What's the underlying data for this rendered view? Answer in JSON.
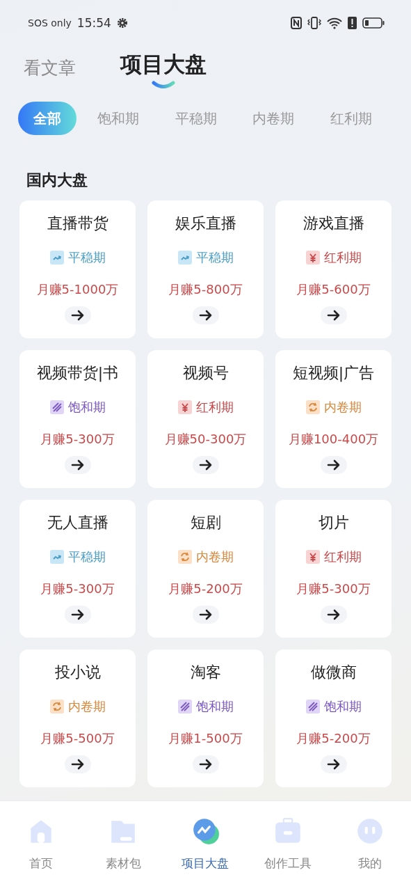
{
  "status_bar": {
    "carrier": "SOS only",
    "time": "15:54"
  },
  "top_tabs": [
    {
      "label": "看文章",
      "selected": false
    },
    {
      "label": "项目大盘",
      "selected": true
    }
  ],
  "filters": [
    {
      "label": "全部",
      "selected": true
    },
    {
      "label": "饱和期",
      "selected": false
    },
    {
      "label": "平稳期",
      "selected": false
    },
    {
      "label": "内卷期",
      "selected": false
    },
    {
      "label": "红利期",
      "selected": false
    }
  ],
  "section_title": "国内大盘",
  "projects": [
    {
      "name": "直播带货",
      "phase": "平稳期",
      "kind": "stable",
      "earnings": "月赚5-1000万"
    },
    {
      "name": "娱乐直播",
      "phase": "平稳期",
      "kind": "stable",
      "earnings": "月赚5-800万"
    },
    {
      "name": "游戏直播",
      "phase": "红利期",
      "kind": "bonus",
      "earnings": "月赚5-600万"
    },
    {
      "name": "视频带货|书",
      "phase": "饱和期",
      "kind": "saturated",
      "earnings": "月赚5-300万"
    },
    {
      "name": "视频号",
      "phase": "红利期",
      "kind": "bonus",
      "earnings": "月赚50-300万"
    },
    {
      "name": "短视频|广告",
      "phase": "内卷期",
      "kind": "involution",
      "earnings": "月赚100-400万"
    },
    {
      "name": "无人直播",
      "phase": "平稳期",
      "kind": "stable",
      "earnings": "月赚5-300万"
    },
    {
      "name": "短剧",
      "phase": "内卷期",
      "kind": "involution",
      "earnings": "月赚5-200万"
    },
    {
      "name": "切片",
      "phase": "红利期",
      "kind": "bonus",
      "earnings": "月赚5-300万"
    },
    {
      "name": "投小说",
      "phase": "内卷期",
      "kind": "involution",
      "earnings": "月赚5-500万"
    },
    {
      "name": "淘客",
      "phase": "饱和期",
      "kind": "saturated",
      "earnings": "月赚1-500万"
    },
    {
      "name": "做微商",
      "phase": "饱和期",
      "kind": "saturated",
      "earnings": "月赚5-200万"
    }
  ],
  "bottom_nav": [
    {
      "label": "首页",
      "kind": "home",
      "selected": false
    },
    {
      "label": "素材包",
      "kind": "folder",
      "selected": false
    },
    {
      "label": "项目大盘",
      "kind": "chart",
      "selected": true
    },
    {
      "label": "创作工具",
      "kind": "case",
      "selected": false
    },
    {
      "label": "我的",
      "kind": "face",
      "selected": false
    }
  ]
}
